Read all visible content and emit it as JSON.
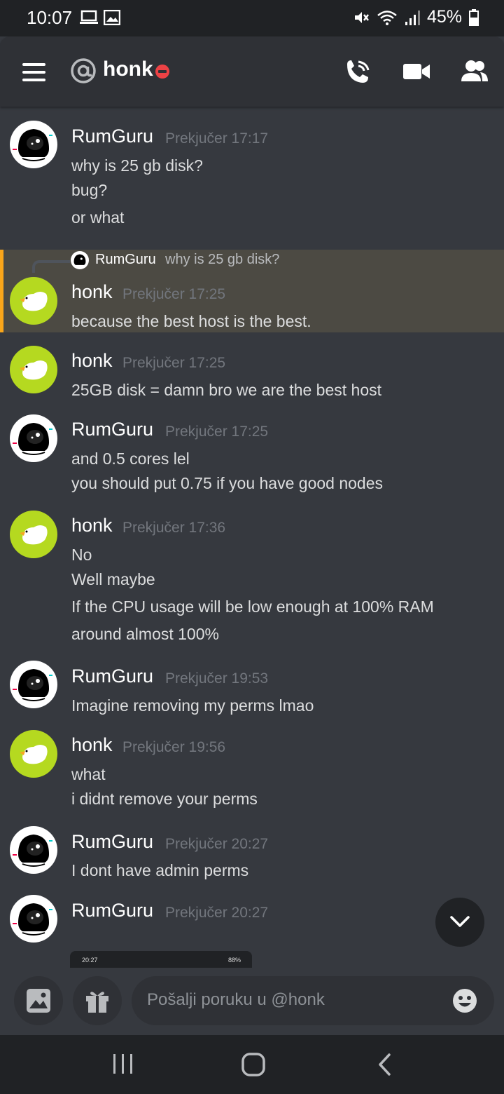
{
  "status": {
    "time": "10:07",
    "battery": "45%"
  },
  "header": {
    "title": "honk",
    "at_symbol": "@",
    "status": "dnd"
  },
  "messages": [
    {
      "author": "RumGuru",
      "time": "Prekjučer 17:17",
      "lines": [
        "why is 25 gb disk?",
        "bug?",
        "or what"
      ]
    },
    {
      "author": "honk",
      "time": "Prekjučer 17:25",
      "reply_to": {
        "author": "RumGuru",
        "text": "why is 25 gb disk?"
      },
      "lines": [
        "because the best host is the best."
      ]
    },
    {
      "author": "honk",
      "time": "Prekjučer 17:25",
      "lines": [
        "25GB disk = damn bro we are the best host"
      ]
    },
    {
      "author": "RumGuru",
      "time": "Prekjučer 17:25",
      "lines": [
        "and 0.5 cores lel",
        "you should put 0.75 if you have good nodes"
      ]
    },
    {
      "author": "honk",
      "time": "Prekjučer 17:36",
      "lines": [
        "No",
        "Well maybe",
        "If the CPU usage will be low enough at 100% RAM",
        "around almost 100%"
      ]
    },
    {
      "author": "RumGuru",
      "time": "Prekjučer 19:53",
      "lines": [
        "Imagine removing my perms lmao"
      ]
    },
    {
      "author": "honk",
      "time": "Prekjučer 19:56",
      "lines": [
        "what",
        "i didnt remove your perms"
      ]
    },
    {
      "author": "RumGuru",
      "time": "Prekjučer 20:27",
      "lines": [
        "I dont have admin perms"
      ]
    },
    {
      "author": "RumGuru",
      "time": "Prekjučer 20:27",
      "lines": []
    }
  ],
  "attachment": {
    "time": "20:27",
    "battery": "88%"
  },
  "composer": {
    "placeholder": "Pošalji poruku u @honk"
  },
  "colors": {
    "background": "#36393f",
    "header": "#2f3136",
    "dnd": "#ed4245",
    "reply_highlight": "#faa61a",
    "honk_avatar": "#b5d920"
  }
}
